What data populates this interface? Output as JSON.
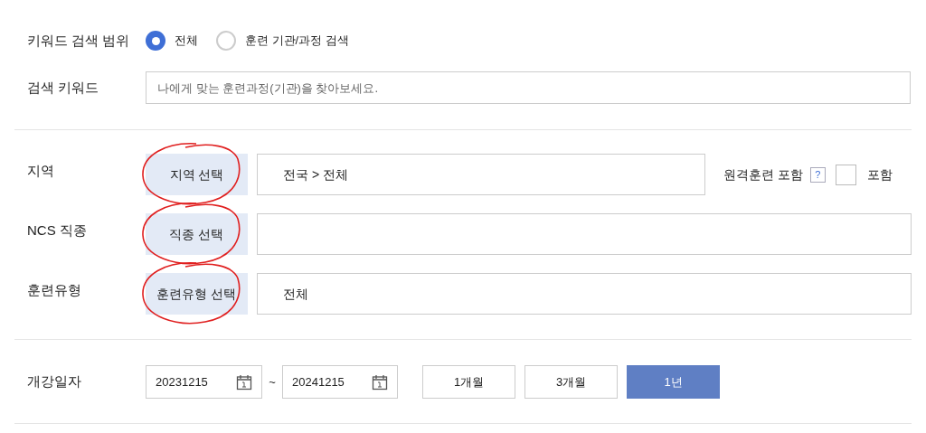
{
  "scope": {
    "label": "키워드 검색 범위",
    "options": [
      {
        "label": "전체",
        "selected": true
      },
      {
        "label": "훈련 기관/과정 검색",
        "selected": false
      }
    ]
  },
  "keyword": {
    "label": "검색 키워드",
    "placeholder": "나에게 맞는 훈련과정(기관)을 찾아보세요."
  },
  "filters": [
    {
      "label": "지역",
      "button": "지역 선택",
      "circled": true,
      "value": "전국 > 전체",
      "remote": {
        "label": "원격훈련 포함",
        "help": "?",
        "checkbox_label": "포함",
        "checked": false
      }
    },
    {
      "label": "NCS 직종",
      "button": "직종 선택",
      "circled": true
    },
    {
      "label": "훈련유형",
      "button": "훈련유형 선택",
      "circled": true,
      "value": "전체"
    }
  ],
  "date": {
    "label": "개강일자",
    "from": "20231215",
    "separator": "~",
    "to": "20241215",
    "periods": [
      {
        "label": "1개월",
        "selected": false
      },
      {
        "label": "3개월",
        "selected": false
      },
      {
        "label": "1년",
        "selected": true
      }
    ]
  }
}
